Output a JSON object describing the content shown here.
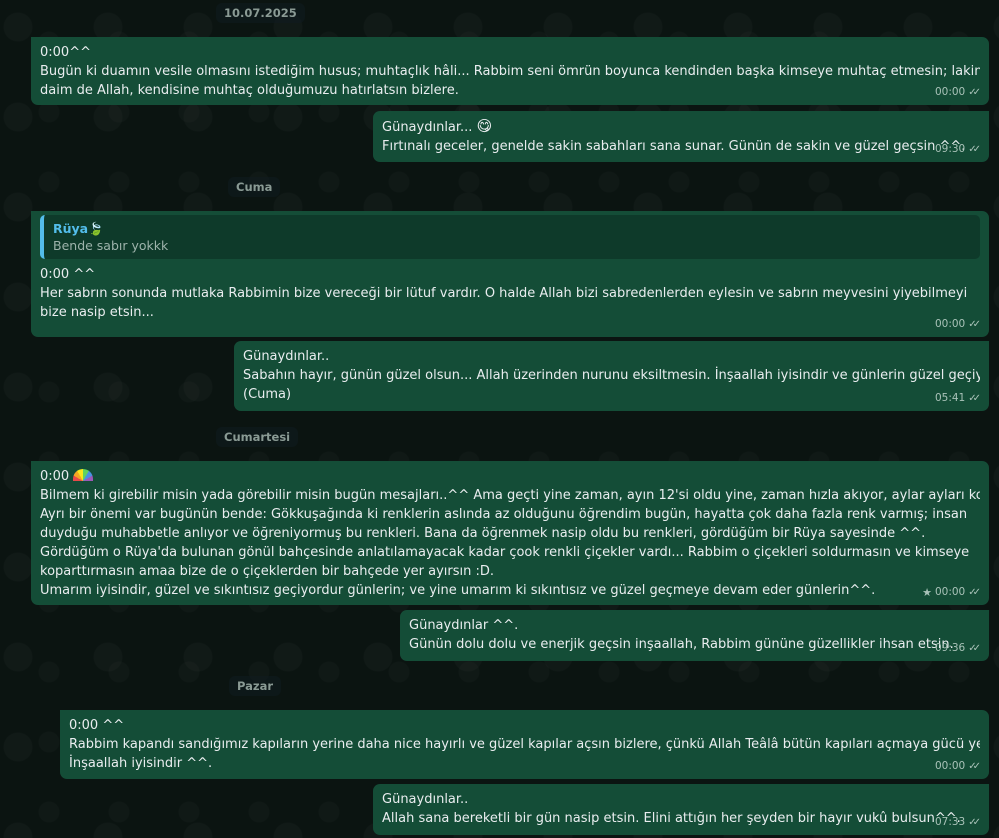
{
  "dividers": {
    "top": "10.07.2025",
    "cuma": "Cuma",
    "cumartesi": "Cumartesi",
    "pazar": "Pazar"
  },
  "messages": [
    {
      "lines": [
        "0:00^^",
        "Bugün ki duamın vesile olmasını istediğim husus; muhtaçlık hâli... Rabbim seni ömrün boyunca kendinden başka kimseye muhtaç etmesin; lakin her",
        "daim de Allah, kendisine muhtaç olduğumuzu hatırlatsın bizlere."
      ],
      "time": "00:00"
    },
    {
      "lines": [
        "Günaydınlar...",
        "Fırtınalı geceler, genelde sakin sabahları sana sunar. Günün de sakin ve güzel geçsin ^^."
      ],
      "time": "09:30",
      "emoji": "😋"
    },
    {
      "quote_author": "Rüya",
      "quote_text": "Bende sabır yokkk",
      "lines": [
        "0:00 ^^",
        "Her sabrın sonunda mutlaka Rabbimin bize vereceği bir lütuf vardır. O halde Allah bizi sabredenlerden eylesin ve sabrın meyvesini yiyebilmeyi",
        "bize nasip etsin..."
      ],
      "time": "00:00",
      "quote_emoji": "🍃"
    },
    {
      "lines": [
        "Günaydınlar..",
        "Sabahın hayır, günün güzel olsun... Allah üzerinden nurunu eksiltmesin. İnşaallah iyisindir ve günlerin güzel geçiyordur..",
        "(Cuma)"
      ],
      "time": "05:41"
    },
    {
      "lines": [
        "0:00",
        "Bilmem ki girebilir misin yada görebilir misin bugün mesajları..^^ Ama geçti yine zaman, ayın 12'si oldu yine, zaman hızla akıyor, aylar ayları kovalıyor...",
        "Ayrı bir önemi var bugünün bende: Gökkuşağında ki renklerin aslında az olduğunu öğrendim bugün, hayatta çok daha fazla renk varmış; insan",
        "duyduğu muhabbetle anlıyor ve öğreniyormuş bu renkleri. Bana da öğrenmek nasip oldu bu renkleri, gördüğüm bir Rüya sayesinde ^^.",
        "Gördüğüm o Rüya'da bulunan gönül bahçesinde anlatılamayacak kadar çook renkli çiçekler vardı... Rabbim o çiçekleri soldurmasın ve kimseye",
        "koparttırmasın amaa bize de o çiçeklerden bir bahçede yer ayırsın :D.",
        "Umarım iyisindir, güzel ve sıkıntısız geçiyordur günlerin; ve yine umarım ki sıkıntısız ve güzel geçmeye devam eder günlerin^^."
      ],
      "time": "00:00",
      "starred": "★"
    },
    {
      "lines": [
        "Günaydınlar ^^.",
        "Günün dolu dolu ve enerjik geçsin inşaallah, Rabbim gününe güzellikler ihsan etsin."
      ],
      "time": "09:36"
    },
    {
      "lines": [
        "0:00 ^^",
        "Rabbim kapandı sandığımız kapıların yerine daha nice hayırlı ve güzel kapılar açsın bizlere, çünkü Allah Teâlâ bütün kapıları açmaya gücü yetendir...",
        "İnşaallah iyisindir ^^."
      ],
      "time": "00:00"
    },
    {
      "lines": [
        "Günaydınlar..",
        "Allah sana bereketli bir gün nasip etsin. Elini attığın her şeyden bir hayır vukû bulsun^^."
      ],
      "time": "07:33"
    }
  ],
  "ticks": "✓✓"
}
